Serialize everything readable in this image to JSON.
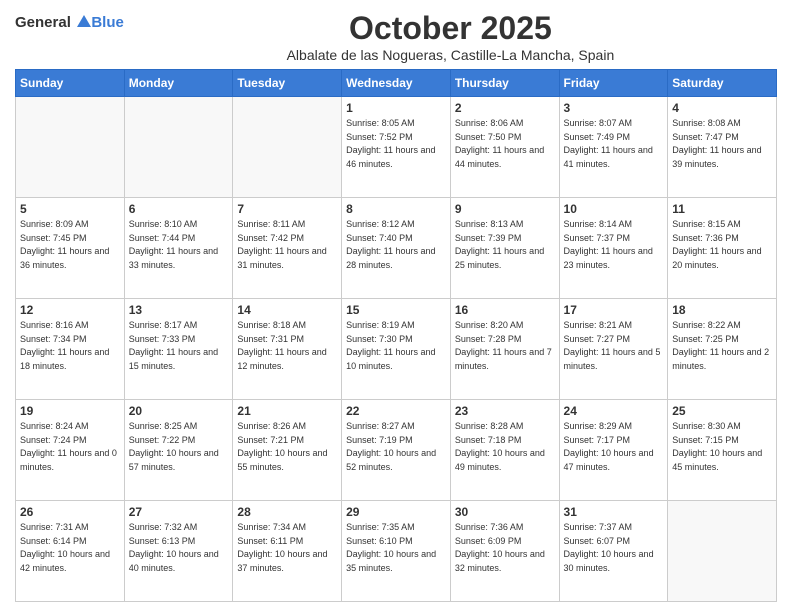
{
  "logo": {
    "general": "General",
    "blue": "Blue"
  },
  "header": {
    "title": "October 2025",
    "subtitle": "Albalate de las Nogueras, Castille-La Mancha, Spain"
  },
  "weekdays": [
    "Sunday",
    "Monday",
    "Tuesday",
    "Wednesday",
    "Thursday",
    "Friday",
    "Saturday"
  ],
  "weeks": [
    [
      {
        "day": "",
        "sunrise": "",
        "sunset": "",
        "daylight": ""
      },
      {
        "day": "",
        "sunrise": "",
        "sunset": "",
        "daylight": ""
      },
      {
        "day": "",
        "sunrise": "",
        "sunset": "",
        "daylight": ""
      },
      {
        "day": "1",
        "sunrise": "Sunrise: 8:05 AM",
        "sunset": "Sunset: 7:52 PM",
        "daylight": "Daylight: 11 hours and 46 minutes."
      },
      {
        "day": "2",
        "sunrise": "Sunrise: 8:06 AM",
        "sunset": "Sunset: 7:50 PM",
        "daylight": "Daylight: 11 hours and 44 minutes."
      },
      {
        "day": "3",
        "sunrise": "Sunrise: 8:07 AM",
        "sunset": "Sunset: 7:49 PM",
        "daylight": "Daylight: 11 hours and 41 minutes."
      },
      {
        "day": "4",
        "sunrise": "Sunrise: 8:08 AM",
        "sunset": "Sunset: 7:47 PM",
        "daylight": "Daylight: 11 hours and 39 minutes."
      }
    ],
    [
      {
        "day": "5",
        "sunrise": "Sunrise: 8:09 AM",
        "sunset": "Sunset: 7:45 PM",
        "daylight": "Daylight: 11 hours and 36 minutes."
      },
      {
        "day": "6",
        "sunrise": "Sunrise: 8:10 AM",
        "sunset": "Sunset: 7:44 PM",
        "daylight": "Daylight: 11 hours and 33 minutes."
      },
      {
        "day": "7",
        "sunrise": "Sunrise: 8:11 AM",
        "sunset": "Sunset: 7:42 PM",
        "daylight": "Daylight: 11 hours and 31 minutes."
      },
      {
        "day": "8",
        "sunrise": "Sunrise: 8:12 AM",
        "sunset": "Sunset: 7:40 PM",
        "daylight": "Daylight: 11 hours and 28 minutes."
      },
      {
        "day": "9",
        "sunrise": "Sunrise: 8:13 AM",
        "sunset": "Sunset: 7:39 PM",
        "daylight": "Daylight: 11 hours and 25 minutes."
      },
      {
        "day": "10",
        "sunrise": "Sunrise: 8:14 AM",
        "sunset": "Sunset: 7:37 PM",
        "daylight": "Daylight: 11 hours and 23 minutes."
      },
      {
        "day": "11",
        "sunrise": "Sunrise: 8:15 AM",
        "sunset": "Sunset: 7:36 PM",
        "daylight": "Daylight: 11 hours and 20 minutes."
      }
    ],
    [
      {
        "day": "12",
        "sunrise": "Sunrise: 8:16 AM",
        "sunset": "Sunset: 7:34 PM",
        "daylight": "Daylight: 11 hours and 18 minutes."
      },
      {
        "day": "13",
        "sunrise": "Sunrise: 8:17 AM",
        "sunset": "Sunset: 7:33 PM",
        "daylight": "Daylight: 11 hours and 15 minutes."
      },
      {
        "day": "14",
        "sunrise": "Sunrise: 8:18 AM",
        "sunset": "Sunset: 7:31 PM",
        "daylight": "Daylight: 11 hours and 12 minutes."
      },
      {
        "day": "15",
        "sunrise": "Sunrise: 8:19 AM",
        "sunset": "Sunset: 7:30 PM",
        "daylight": "Daylight: 11 hours and 10 minutes."
      },
      {
        "day": "16",
        "sunrise": "Sunrise: 8:20 AM",
        "sunset": "Sunset: 7:28 PM",
        "daylight": "Daylight: 11 hours and 7 minutes."
      },
      {
        "day": "17",
        "sunrise": "Sunrise: 8:21 AM",
        "sunset": "Sunset: 7:27 PM",
        "daylight": "Daylight: 11 hours and 5 minutes."
      },
      {
        "day": "18",
        "sunrise": "Sunrise: 8:22 AM",
        "sunset": "Sunset: 7:25 PM",
        "daylight": "Daylight: 11 hours and 2 minutes."
      }
    ],
    [
      {
        "day": "19",
        "sunrise": "Sunrise: 8:24 AM",
        "sunset": "Sunset: 7:24 PM",
        "daylight": "Daylight: 11 hours and 0 minutes."
      },
      {
        "day": "20",
        "sunrise": "Sunrise: 8:25 AM",
        "sunset": "Sunset: 7:22 PM",
        "daylight": "Daylight: 10 hours and 57 minutes."
      },
      {
        "day": "21",
        "sunrise": "Sunrise: 8:26 AM",
        "sunset": "Sunset: 7:21 PM",
        "daylight": "Daylight: 10 hours and 55 minutes."
      },
      {
        "day": "22",
        "sunrise": "Sunrise: 8:27 AM",
        "sunset": "Sunset: 7:19 PM",
        "daylight": "Daylight: 10 hours and 52 minutes."
      },
      {
        "day": "23",
        "sunrise": "Sunrise: 8:28 AM",
        "sunset": "Sunset: 7:18 PM",
        "daylight": "Daylight: 10 hours and 49 minutes."
      },
      {
        "day": "24",
        "sunrise": "Sunrise: 8:29 AM",
        "sunset": "Sunset: 7:17 PM",
        "daylight": "Daylight: 10 hours and 47 minutes."
      },
      {
        "day": "25",
        "sunrise": "Sunrise: 8:30 AM",
        "sunset": "Sunset: 7:15 PM",
        "daylight": "Daylight: 10 hours and 45 minutes."
      }
    ],
    [
      {
        "day": "26",
        "sunrise": "Sunrise: 7:31 AM",
        "sunset": "Sunset: 6:14 PM",
        "daylight": "Daylight: 10 hours and 42 minutes."
      },
      {
        "day": "27",
        "sunrise": "Sunrise: 7:32 AM",
        "sunset": "Sunset: 6:13 PM",
        "daylight": "Daylight: 10 hours and 40 minutes."
      },
      {
        "day": "28",
        "sunrise": "Sunrise: 7:34 AM",
        "sunset": "Sunset: 6:11 PM",
        "daylight": "Daylight: 10 hours and 37 minutes."
      },
      {
        "day": "29",
        "sunrise": "Sunrise: 7:35 AM",
        "sunset": "Sunset: 6:10 PM",
        "daylight": "Daylight: 10 hours and 35 minutes."
      },
      {
        "day": "30",
        "sunrise": "Sunrise: 7:36 AM",
        "sunset": "Sunset: 6:09 PM",
        "daylight": "Daylight: 10 hours and 32 minutes."
      },
      {
        "day": "31",
        "sunrise": "Sunrise: 7:37 AM",
        "sunset": "Sunset: 6:07 PM",
        "daylight": "Daylight: 10 hours and 30 minutes."
      },
      {
        "day": "",
        "sunrise": "",
        "sunset": "",
        "daylight": ""
      }
    ]
  ]
}
